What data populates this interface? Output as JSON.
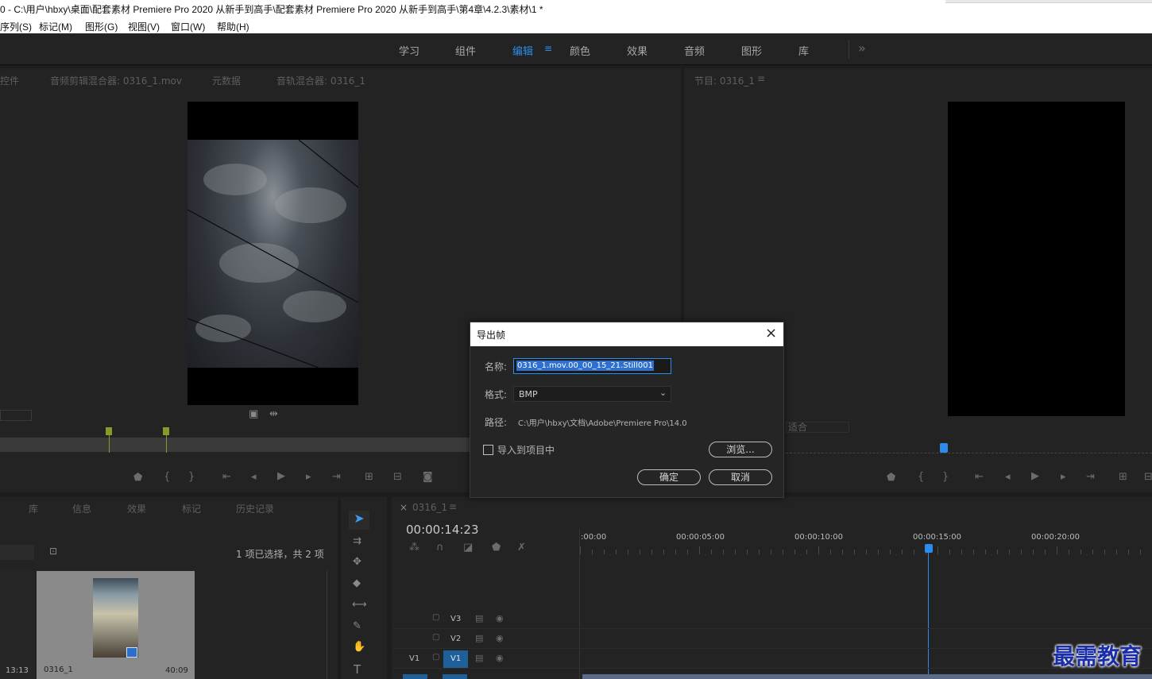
{
  "window": {
    "title": "0 - C:\\用户\\hbxy\\桌面\\配套素材 Premiere Pro 2020 从新手到高手\\配套素材 Premiere Pro 2020 从新手到高手\\第4章\\4.2.3\\素材\\1 *"
  },
  "menu": [
    "序列(S)",
    "标记(M)",
    "图形(G)",
    "视图(V)",
    "窗口(W)",
    "帮助(H)"
  ],
  "workspace_tabs": [
    {
      "label": "学习",
      "active": false
    },
    {
      "label": "组件",
      "active": false
    },
    {
      "label": "编辑",
      "active": true
    },
    {
      "label": "颜色",
      "active": false
    },
    {
      "label": "效果",
      "active": false
    },
    {
      "label": "音频",
      "active": false
    },
    {
      "label": "图形",
      "active": false
    },
    {
      "label": "库",
      "active": false
    }
  ],
  "workspace_more": "»",
  "source_panel": {
    "tabs": [
      "控件",
      "音频剪辑混合器: 0316_1.mov",
      "元数据",
      "音轨混合器: 0316_1"
    ]
  },
  "program_panel": {
    "tab": "节目: 0316_1",
    "fit_label": "适合"
  },
  "project_panel": {
    "tabs": [
      "库",
      "信息",
      "效果",
      "标记",
      "历史记录"
    ],
    "selection_status": "1 项已选择，共 2 项",
    "left_clip_duration": "13:13",
    "clip": {
      "name": "0316_1",
      "duration": "40:09"
    }
  },
  "timeline": {
    "tab": "0316_1",
    "timecode": "00:00:14:23",
    "ruler": [
      ":00:00",
      "00:00:05:00",
      "00:00:10:00",
      "00:00:15:00",
      "00:00:20:00"
    ],
    "tracks": [
      {
        "source": "",
        "name": "V3"
      },
      {
        "source": "",
        "name": "V2"
      },
      {
        "source": "V1",
        "name": "V1"
      }
    ]
  },
  "dialog": {
    "title": "导出帧",
    "name_label": "名称:",
    "name_value": "0316_1.mov.00_00_15_21.Still001",
    "format_label": "格式:",
    "format_value": "BMP",
    "path_label": "路径:",
    "path_value": "C:\\用户\\hbxy\\文档\\Adobe\\Premiere Pro\\14.0",
    "import_label": "导入到项目中",
    "browse_label": "浏览...",
    "ok_label": "确定",
    "cancel_label": "取消"
  },
  "watermark": "最需教育",
  "colors": {
    "accent": "#2d8ceb",
    "panel_bg": "#232323",
    "dialog_bg": "#252525",
    "playhead": "#2d8ceb",
    "marker": "#8a9a2a"
  }
}
